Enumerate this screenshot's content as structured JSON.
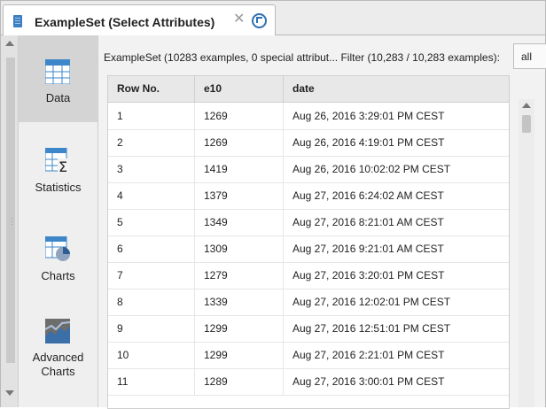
{
  "tab": {
    "title": "ExampleSet (Select Attributes)",
    "close_glyph": "✕"
  },
  "views": [
    {
      "label": "Data",
      "icon": "data-table-icon"
    },
    {
      "label": "Statistics",
      "icon": "statistics-icon"
    },
    {
      "label": "Charts",
      "icon": "charts-icon"
    },
    {
      "label": "Advanced Charts",
      "line1": "Advanced",
      "line2": "Charts",
      "icon": "advanced-charts-icon"
    }
  ],
  "info_text": "ExampleSet (10283 examples, 0 special attribut... Filter (10,283 / 10,283 examples):",
  "filter_value": "all",
  "table": {
    "columns": [
      "Row No.",
      "e10",
      "date"
    ],
    "rows": [
      [
        "1",
        "1269",
        "Aug 26, 2016 3:29:01 PM CEST"
      ],
      [
        "2",
        "1269",
        "Aug 26, 2016 4:19:01 PM CEST"
      ],
      [
        "3",
        "1419",
        "Aug 26, 2016 10:02:02 PM CEST"
      ],
      [
        "4",
        "1379",
        "Aug 27, 2016 6:24:02 AM CEST"
      ],
      [
        "5",
        "1349",
        "Aug 27, 2016 8:21:01 AM CEST"
      ],
      [
        "6",
        "1309",
        "Aug 27, 2016 9:21:01 AM CEST"
      ],
      [
        "7",
        "1279",
        "Aug 27, 2016 3:20:01 PM CEST"
      ],
      [
        "8",
        "1339",
        "Aug 27, 2016 12:02:01 PM CEST"
      ],
      [
        "9",
        "1299",
        "Aug 27, 2016 12:51:01 PM CEST"
      ],
      [
        "10",
        "1299",
        "Aug 27, 2016 2:21:01 PM CEST"
      ],
      [
        "11",
        "1289",
        "Aug 27, 2016 3:00:01 PM CEST"
      ]
    ]
  },
  "colors": {
    "accent": "#2f6fb5",
    "active_view": "#d4d4d4",
    "header_bg": "#e8e8e8"
  }
}
